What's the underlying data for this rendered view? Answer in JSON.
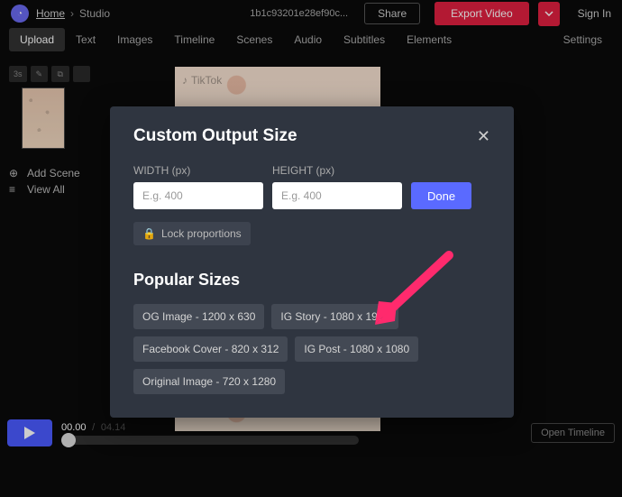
{
  "header": {
    "home": "Home",
    "crumb_sep": "›",
    "current": "Studio",
    "project_name": "1b1c93201e28ef90c...",
    "share": "Share",
    "export": "Export Video",
    "signin": "Sign In"
  },
  "tabs": [
    "Upload",
    "Text",
    "Images",
    "Timeline",
    "Scenes",
    "Audio",
    "Subtitles",
    "Elements"
  ],
  "tabs_right": "Settings",
  "scene": {
    "duration_badge": "3s",
    "add": "Add Scene",
    "viewall": "View All"
  },
  "canvas": {
    "watermark": "TikTok"
  },
  "player": {
    "current": "00.00",
    "sep": "/",
    "total": "04.14",
    "open_timeline": "Open Timeline"
  },
  "modal": {
    "title": "Custom Output Size",
    "width_label": "WIDTH (px)",
    "height_label": "HEIGHT (px)",
    "placeholder": "E.g. 400",
    "done": "Done",
    "lock": "Lock proportions",
    "popular_title": "Popular Sizes",
    "sizes": [
      "OG Image - 1200 x 630",
      "IG Story - 1080 x 1920",
      "Facebook Cover - 820 x 312",
      "IG Post - 1080 x 1080",
      "Original Image - 720 x 1280"
    ]
  }
}
